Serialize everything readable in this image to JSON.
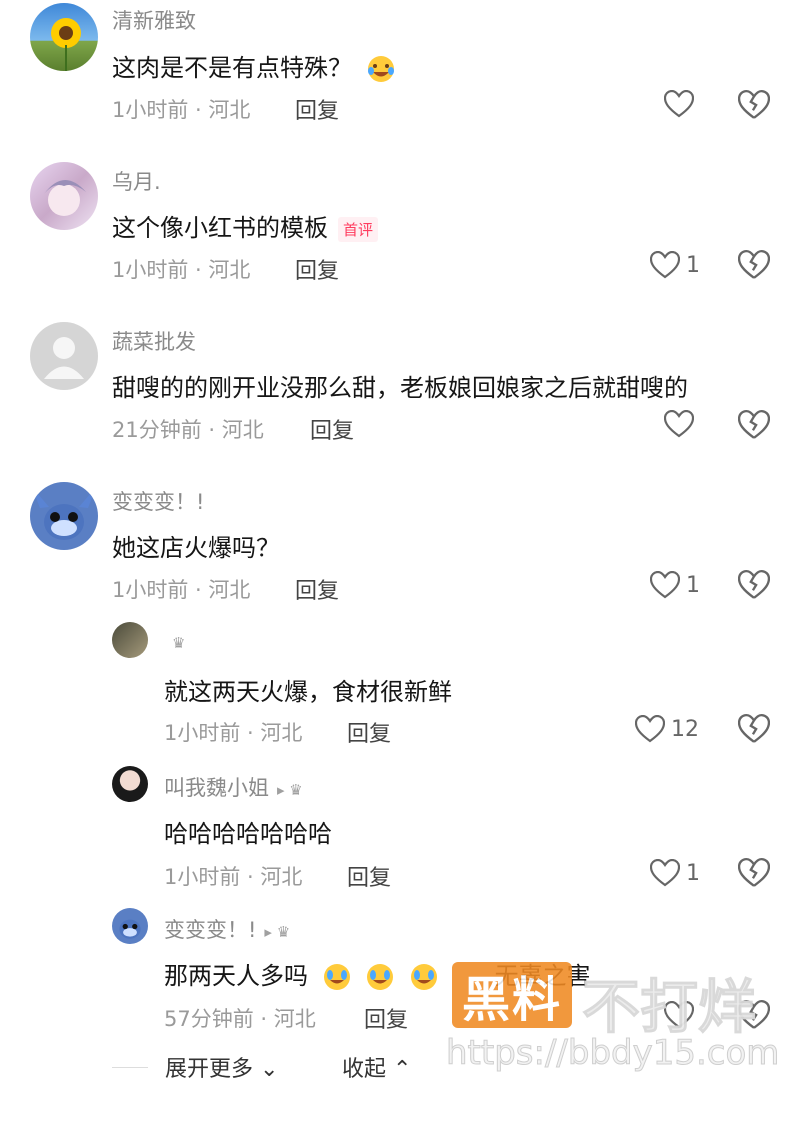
{
  "comments": [
    {
      "name": "清新雅致",
      "text": "这肉是不是有点特殊？",
      "time": "1小时前 · 河北",
      "reply": "回复",
      "likes": ""
    },
    {
      "name": "乌月.",
      "text": "这个像小红书的模板",
      "tag": "首评",
      "time": "1小时前 · 河北",
      "reply": "回复",
      "likes": "1"
    },
    {
      "name": "蔬菜批发",
      "text": "甜嗖的的刚开业没那么甜，老板娘回娘家之后就甜嗖的",
      "time": "21分钟前 · 河北",
      "reply": "回复",
      "likes": ""
    },
    {
      "name": "变变变！!",
      "text": "她这店火爆吗？",
      "time": "1小时前 · 河北",
      "reply": "回复",
      "likes": "1"
    }
  ],
  "replies": [
    {
      "name": "",
      "badge": "♛",
      "text": "就这两天火爆，食材很新鲜",
      "time": "1小时前 · 河北",
      "reply": "回复",
      "likes": "12"
    },
    {
      "name": "叫我魏小姐",
      "badge": "▸ ♛",
      "text": "哈哈哈哈哈哈哈",
      "time": "1小时前 · 河北",
      "reply": "回复",
      "likes": "1"
    },
    {
      "name": "变变变！!",
      "badge": "▸ ♛",
      "text": "那两天人多吗",
      "text_tail": "无辜之害",
      "time": "57分钟前 · 河北",
      "reply": "回复",
      "likes": ""
    }
  ],
  "footer": {
    "expand": "展开更多 ⌄",
    "collapse": "收起 ⌃"
  },
  "watermark": {
    "brand": "黑料",
    "slogan": "不打烊",
    "url": "https://bbdy15.com"
  },
  "colors": {
    "tag": "#ff3c5f",
    "watermark_bg": "#f08a23"
  }
}
